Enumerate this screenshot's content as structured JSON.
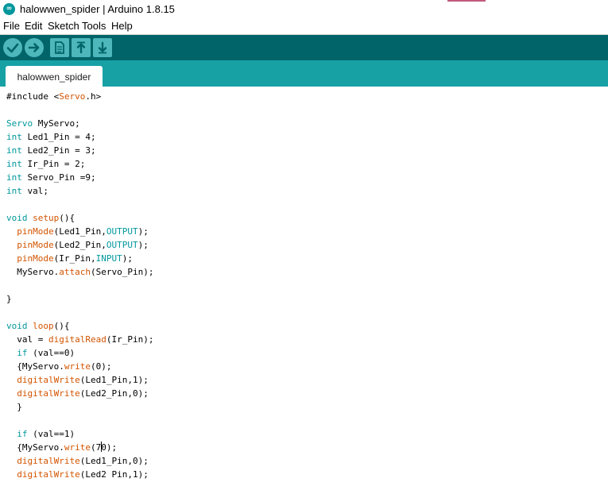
{
  "window": {
    "title": "halowwen_spider | Arduino 1.8.15"
  },
  "menu": [
    "File",
    "Edit",
    "Sketch",
    "Tools",
    "Help"
  ],
  "toolbar": {
    "buttons": [
      {
        "name": "verify-button",
        "icon": "check-icon"
      },
      {
        "name": "upload-button",
        "icon": "arrow-right-icon"
      },
      {
        "name": "new-button",
        "icon": "file-icon"
      },
      {
        "name": "open-button",
        "icon": "arrow-up-icon"
      },
      {
        "name": "save-button",
        "icon": "arrow-down-icon"
      }
    ]
  },
  "tabs": [
    {
      "label": "halowwen_spider",
      "active": true
    }
  ],
  "colors": {
    "toolbar": "#006468",
    "tabstrip": "#17a1a5",
    "button": "#4db7bb",
    "keyword_type": "#00979c",
    "keyword_function": "#d35400"
  },
  "editor": {
    "lines": [
      "#include <Servo.h>",
      "",
      "Servo MyServo;",
      "int Led1_Pin = 4;",
      "int Led2_Pin = 3;",
      "int Ir_Pin = 2;",
      "int Servo_Pin =9;",
      "int val;",
      "",
      "void setup(){",
      "  pinMode(Led1_Pin,OUTPUT);",
      "  pinMode(Led2_Pin,OUTPUT);",
      "  pinMode(Ir_Pin,INPUT);",
      "  MyServo.attach(Servo_Pin);",
      "",
      "}",
      "",
      "void loop(){",
      "  val = digitalRead(Ir_Pin);",
      "  if (val==0)",
      "  {MyServo.write(0);",
      "  digitalWrite(Led1_Pin,1);",
      "  digitalWrite(Led2_Pin,0);",
      "  }",
      "",
      "  if (val==1)",
      "  {MyServo.write(70);",
      "  digitalWrite(Led1_Pin,0);",
      "  digitalWrite(Led2 Pin,1);"
    ]
  }
}
